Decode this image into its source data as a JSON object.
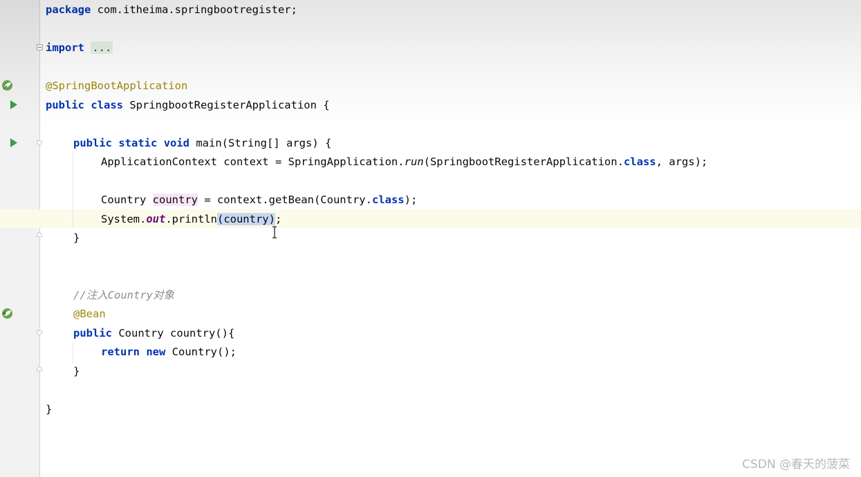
{
  "code": {
    "l1": {
      "kw": "package",
      "text": " com.itheima.springbootregister;"
    },
    "l2": {
      "kw": "import",
      "folded": "..."
    },
    "l3": {
      "annotation": "@SpringBootApplication"
    },
    "l4": {
      "kw1": "public",
      "kw2": "class",
      "text": " SpringbootRegisterApplication {"
    },
    "l5": {
      "kw1": "public",
      "kw2": "static",
      "kw3": "void",
      "text": " main(String[] args) {"
    },
    "l6": {
      "a": "ApplicationContext context = SpringApplication.",
      "method": "run",
      "b": "(SpringbootRegisterApplication.",
      "kw": "class",
      "c": ", args);"
    },
    "l7": {
      "a": "Country ",
      "var": "country",
      "b": " = context.getBean(Country.",
      "kw": "class",
      "c": ");"
    },
    "l8": {
      "a": "System.",
      "field": "out",
      "b": ".println",
      "sel": "(country)",
      "c": ";"
    },
    "l9": {
      "text": "}"
    },
    "l10": {
      "comment": "//注入Country对象"
    },
    "l11": {
      "annotation": "@Bean"
    },
    "l12": {
      "kw": "public",
      "text": " Country country(){"
    },
    "l13": {
      "kw1": "return",
      "kw2": "new",
      "text": " Country();"
    },
    "l14": {
      "text": "}"
    },
    "l15": {
      "text": "}"
    }
  },
  "icons": {
    "spring_bean": "spring-bean-icon",
    "run": "run-icon",
    "fold": "fold-icon"
  },
  "colors": {
    "keyword": "#0033b3",
    "annotation": "#9e880d",
    "comment": "#8c8c8c",
    "run_icon": "#3e9b49",
    "caret_row": "#fcfae9",
    "selection": "#c6d8f3",
    "var_highlight": "#f9e5f5"
  },
  "watermark": "CSDN @春天的菠菜"
}
